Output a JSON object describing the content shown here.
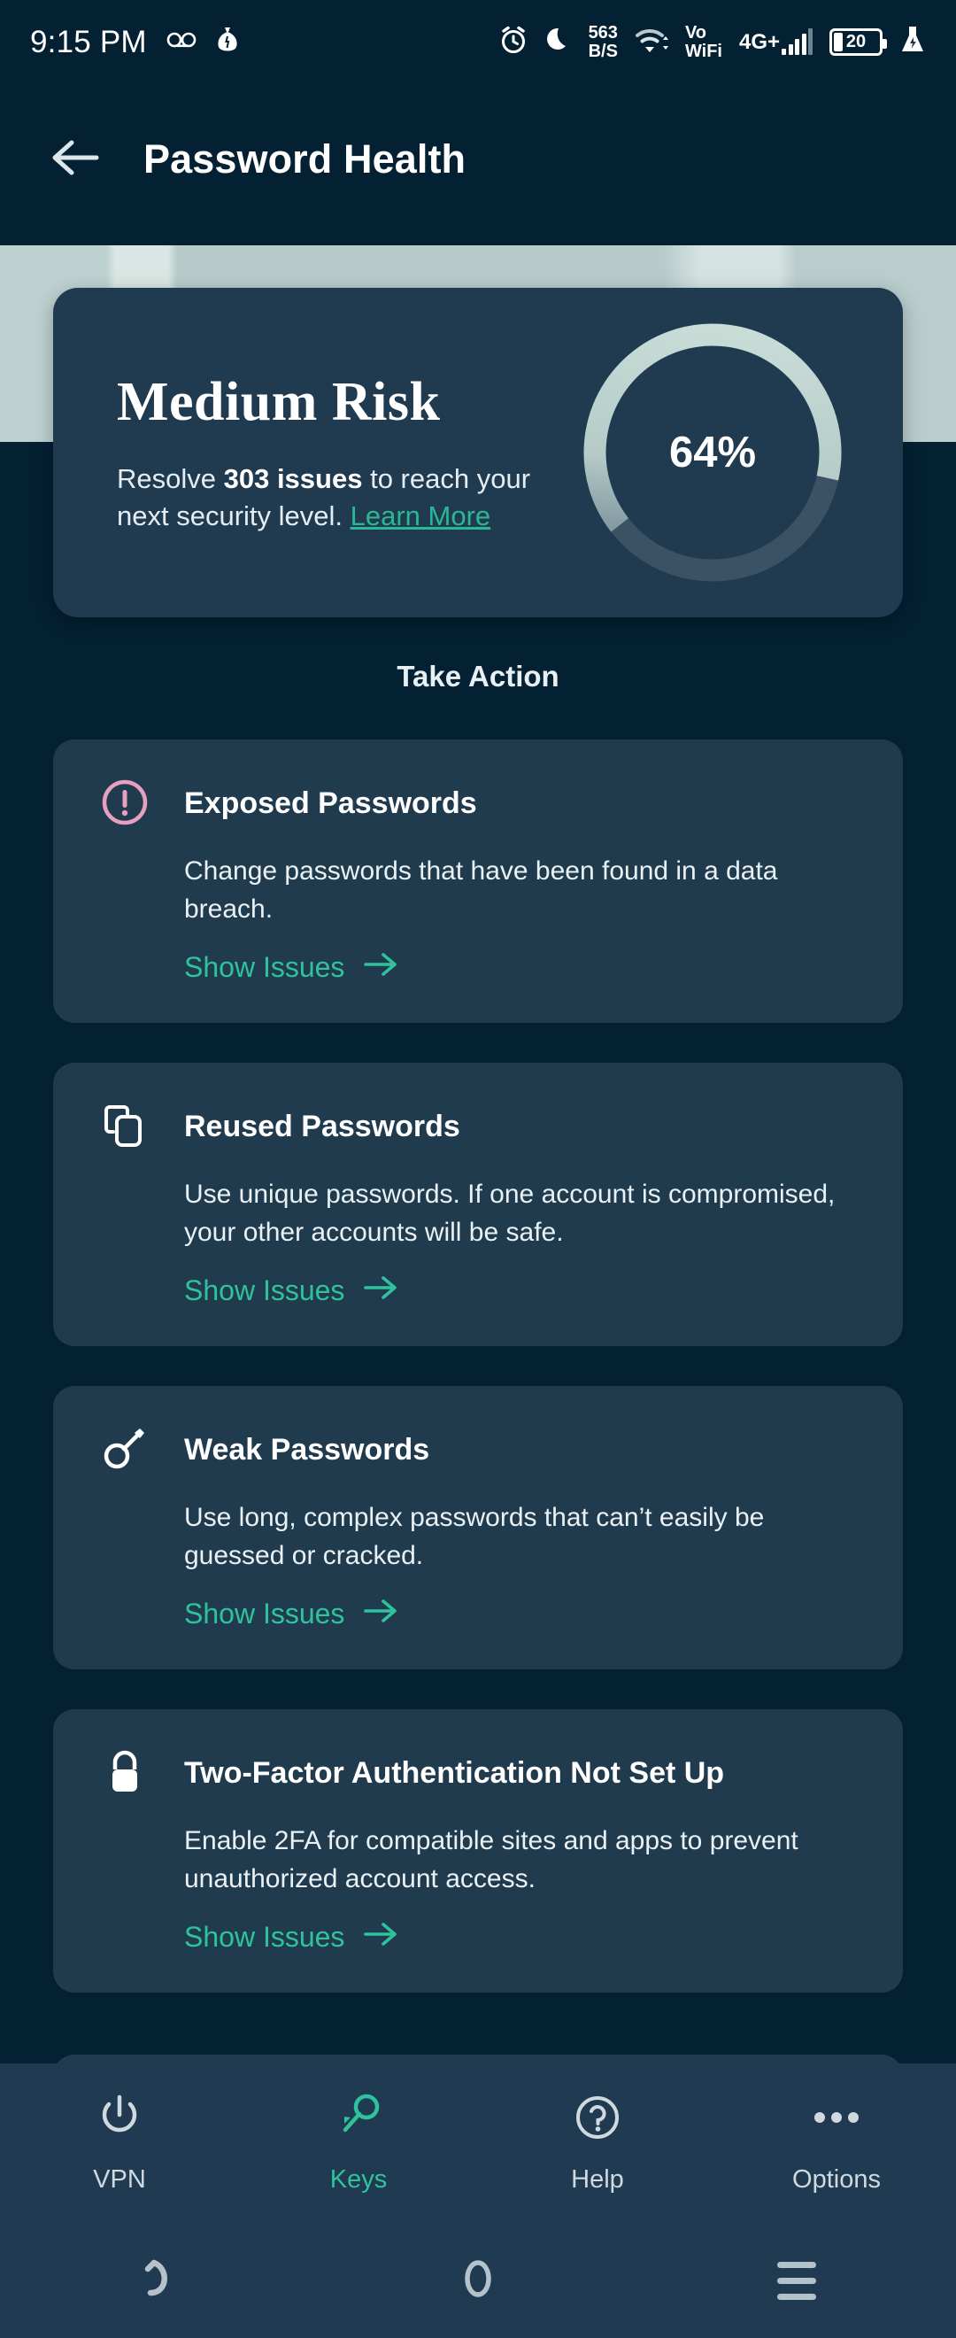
{
  "statusbar": {
    "time": "9:15 PM",
    "left_icons": [
      "voicemail-icon",
      "money-bag-icon"
    ],
    "net_speed_value": "563",
    "net_speed_unit": "B/S",
    "vo_label": "Vo",
    "wifi_label": "WiFi",
    "network_type": "4G+",
    "battery_level": "20",
    "right_icons": [
      "alarm-icon",
      "do-not-disturb-moon-icon",
      "wifi-icon",
      "signal-bars-icon",
      "battery-icon",
      "flask-icon"
    ]
  },
  "appbar": {
    "back_icon": "arrow-left-icon",
    "title": "Password Health"
  },
  "risk": {
    "level": "Medium Risk",
    "sub_prefix": "Resolve ",
    "sub_count": "303 issues",
    "sub_middle": " to reach your next security level. ",
    "learn_more": "Learn More",
    "percent_label": "64%",
    "percent_value": 64,
    "ring_track_color": "#3a5264",
    "ring_progress_color": "#c9ded8"
  },
  "section": {
    "take_action": "Take Action"
  },
  "cards": [
    {
      "icon": "alert-circle-icon",
      "icon_color": "#e8a0c0",
      "title": "Exposed Passwords",
      "description": "Change passwords that have been found in a data breach.",
      "link": "Show Issues",
      "link_icon": "arrow-right-icon"
    },
    {
      "icon": "copy-duplicate-icon",
      "icon_color": "#ffffff",
      "title": "Reused Passwords",
      "description": "Use unique passwords. If one account is compromised, your other accounts will be safe.",
      "link": "Show Issues",
      "link_icon": "arrow-right-icon"
    },
    {
      "icon": "key-icon",
      "icon_color": "#ffffff",
      "title": "Weak Passwords",
      "description": "Use long, complex passwords that can’t easily be guessed or cracked.",
      "link": "Show Issues",
      "link_icon": "arrow-right-icon"
    },
    {
      "icon": "lock-icon",
      "icon_color": "#ffffff",
      "title": "Two-Factor Authentication Not Set Up",
      "description": "Enable 2FA for compatible sites and apps to prevent unauthorized account access.",
      "link": "Show Issues",
      "link_icon": "arrow-right-icon"
    }
  ],
  "bottom_nav": {
    "items": [
      {
        "label": "VPN",
        "icon": "power-icon",
        "active": false
      },
      {
        "label": "Keys",
        "icon": "key-icon",
        "active": true
      },
      {
        "label": "Help",
        "icon": "question-circle-icon",
        "active": false
      },
      {
        "label": "Options",
        "icon": "three-dots-icon",
        "active": false
      }
    ],
    "active_color": "#2ec39c",
    "inactive_color": "#cfd9de"
  },
  "system_nav": {
    "back_icon": "system-back-icon",
    "home_icon": "system-home-icon",
    "recents_icon": "system-recents-icon"
  },
  "theme": {
    "page_background": "#042033",
    "card_background": "#203a4e",
    "accent_teal": "#2ec39c",
    "band_color": "#bdd1d0"
  }
}
